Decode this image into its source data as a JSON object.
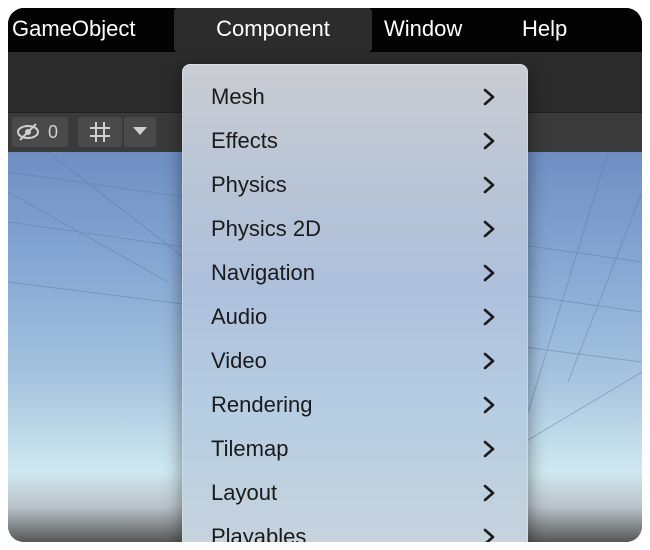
{
  "menubar": {
    "items": [
      {
        "label": "GameObject"
      },
      {
        "label": "Component"
      },
      {
        "label": "Window"
      },
      {
        "label": "Help"
      }
    ]
  },
  "toolbar": {
    "visibility_count": "0"
  },
  "component_menu": {
    "items": [
      {
        "label": "Mesh"
      },
      {
        "label": "Effects"
      },
      {
        "label": "Physics"
      },
      {
        "label": "Physics 2D"
      },
      {
        "label": "Navigation"
      },
      {
        "label": "Audio"
      },
      {
        "label": "Video"
      },
      {
        "label": "Rendering"
      },
      {
        "label": "Tilemap"
      },
      {
        "label": "Layout"
      },
      {
        "label": "Playables"
      }
    ],
    "submenu_icon": "chevron-right-icon"
  }
}
